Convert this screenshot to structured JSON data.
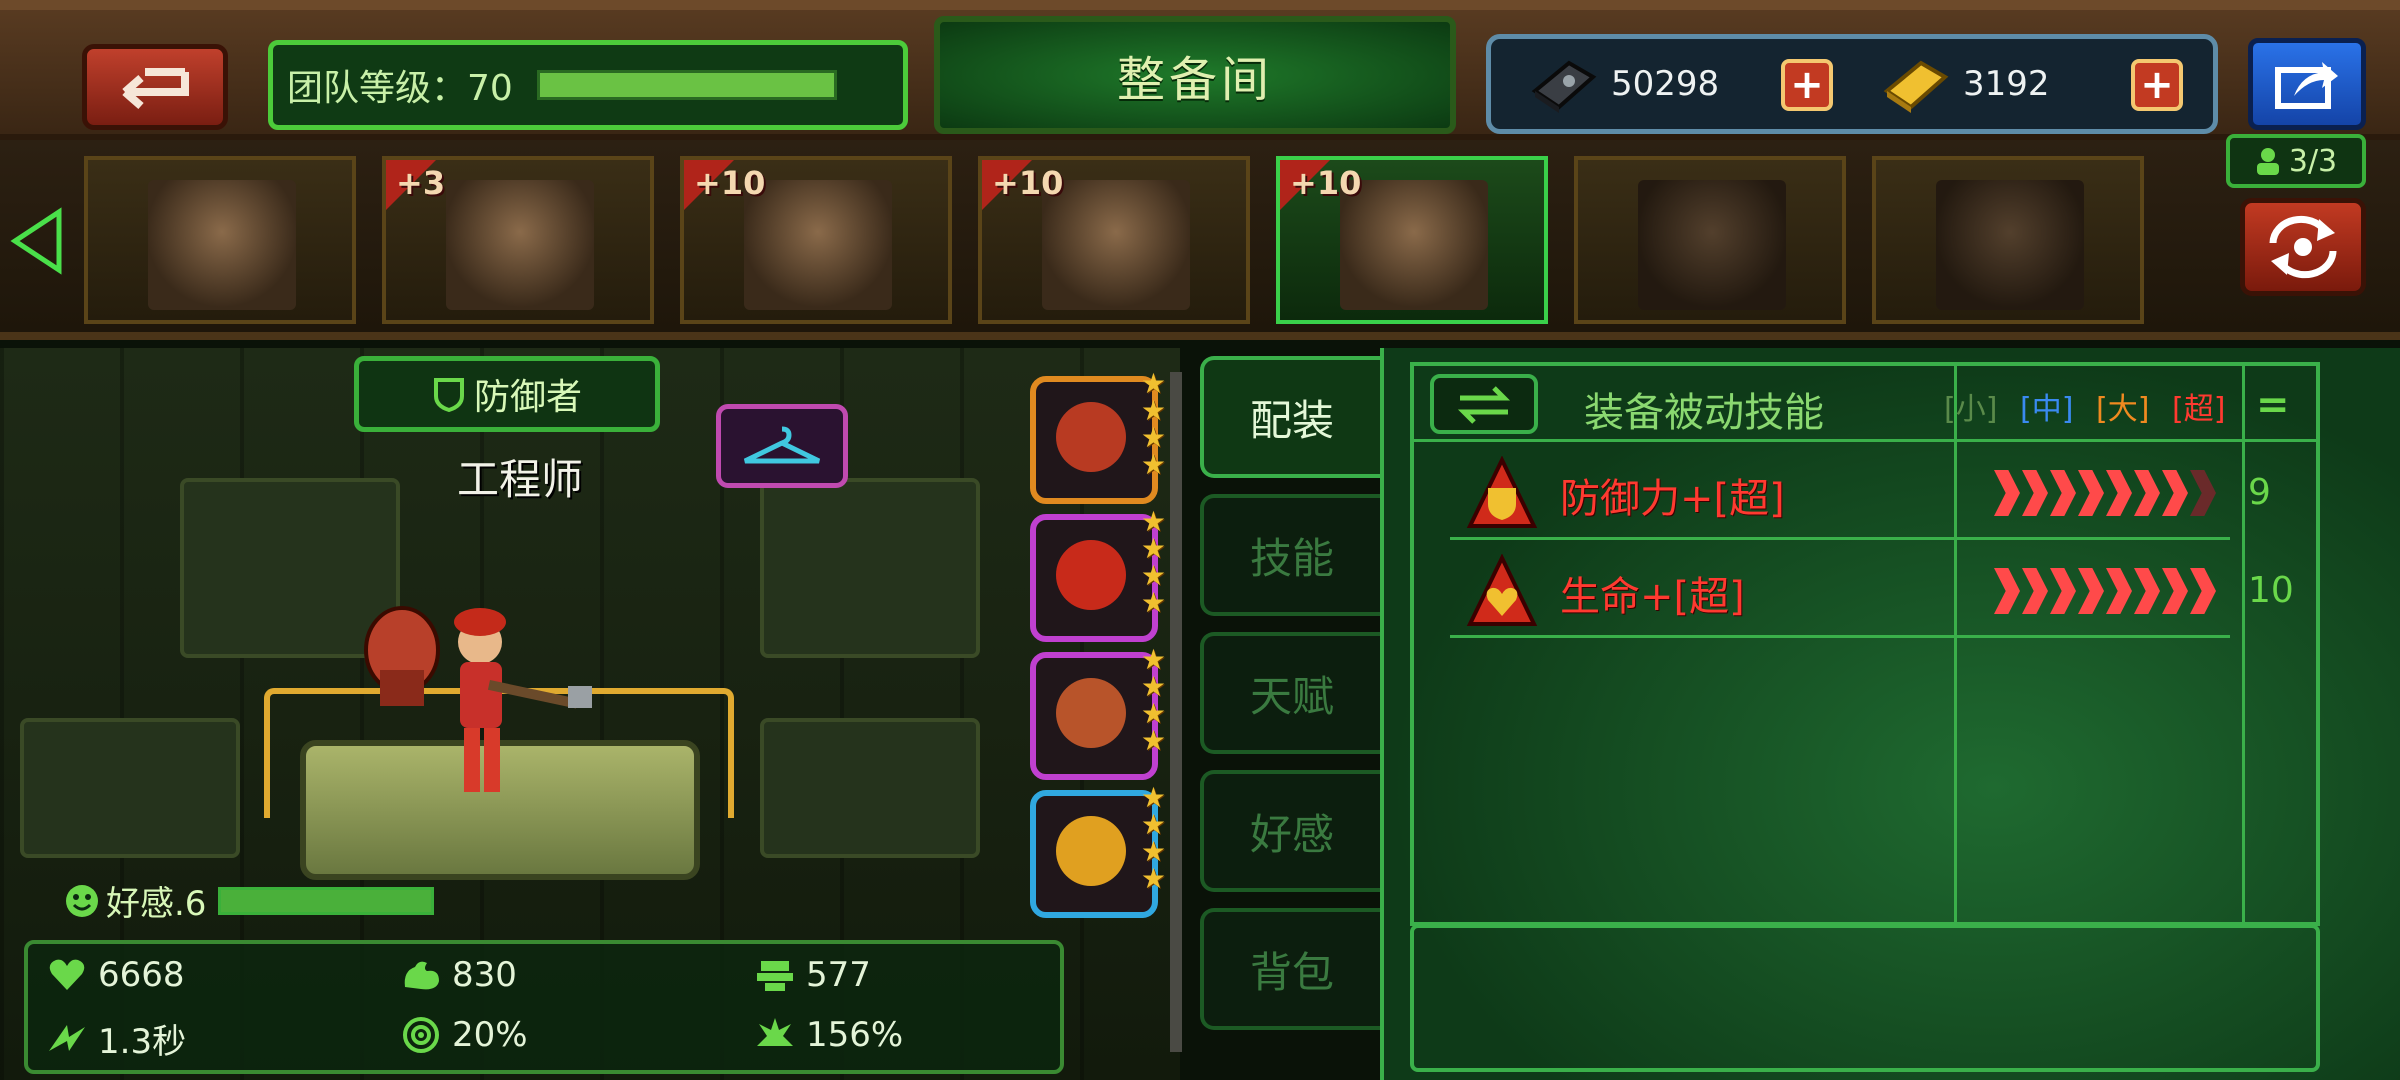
{
  "header": {
    "team_level_label": "团队等级：70",
    "title": "整备间",
    "currency": [
      {
        "icon": "steel-ingot-icon",
        "value": "50298"
      },
      {
        "icon": "gold-bar-icon",
        "value": "3192"
      }
    ],
    "team_level_progress": 1.0
  },
  "roster": {
    "member_count": "3/3",
    "slots": [
      {
        "level": "",
        "selected": false
      },
      {
        "level": "+3",
        "selected": false
      },
      {
        "level": "+10",
        "selected": false
      },
      {
        "level": "+10",
        "selected": false
      },
      {
        "level": "+10",
        "selected": true
      },
      {
        "level": "",
        "selected": false
      },
      {
        "level": "",
        "selected": false
      }
    ]
  },
  "hero": {
    "role": "防御者",
    "name": "工程师",
    "affection_label": "好感.6",
    "affection_progress": 1.0,
    "stats": {
      "hp": "6668",
      "attack": "830",
      "defense": "577",
      "attack_speed": "1.3秒",
      "crit": "20%",
      "crit_damage": "156%"
    }
  },
  "equipment": [
    {
      "name": "missile",
      "stars": 4,
      "frame_color": "#e08a20",
      "item_color": "#b83a22"
    },
    {
      "name": "beret",
      "stars": 4,
      "frame_color": "#c040d0",
      "item_color": "#c82a1a"
    },
    {
      "name": "armor",
      "stars": 4,
      "frame_color": "#c040d0",
      "item_color": "#b8542a"
    },
    {
      "name": "ring",
      "stars": 4,
      "frame_color": "#30a8e0",
      "item_color": "#e0a020"
    }
  ],
  "tabs": [
    "配装",
    "技能",
    "天赋",
    "好感",
    "背包"
  ],
  "active_tab": 0,
  "skills_panel": {
    "title": "装备被动技能",
    "grades": [
      {
        "label": "[小]",
        "color": "#5a8a4a"
      },
      {
        "label": "[中]",
        "color": "#3a8af0"
      },
      {
        "label": "[大]",
        "color": "#f08a20"
      },
      {
        "label": "[超]",
        "color": "#ff3a30"
      }
    ],
    "eq_symbol": "=",
    "rows": [
      {
        "name": "防御力+[超]",
        "count": "9",
        "icon": "defense-shield-icon",
        "level": 0.875
      },
      {
        "name": "生命+[超]",
        "count": "10",
        "icon": "health-heart-icon",
        "level": 1.0
      }
    ]
  }
}
